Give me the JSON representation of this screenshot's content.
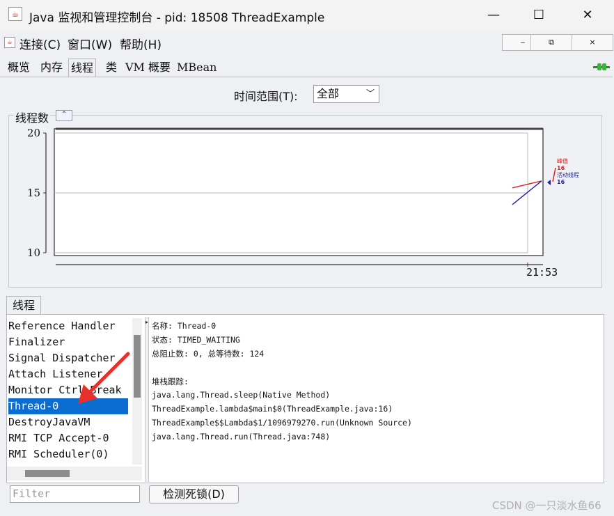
{
  "window": {
    "title": "Java 监视和管理控制台 - pid: 18508 ThreadExample",
    "minimize": "—",
    "maximize": "☐",
    "close": "✕",
    "app_icon": "java-cup-icon"
  },
  "menu": {
    "items": [
      "连接(C)",
      "窗口(W)",
      "帮助(H)"
    ],
    "inner_minimize": "‒",
    "inner_restore": "⧉",
    "inner_close": "×"
  },
  "tabs": [
    {
      "label": "概览",
      "active": false
    },
    {
      "label": "内存",
      "active": false
    },
    {
      "label": "线程",
      "active": true
    },
    {
      "label": "类",
      "active": false
    },
    {
      "label": "VM 概要",
      "active": false
    },
    {
      "label": "MBean",
      "active": false
    }
  ],
  "time_range": {
    "label": "时间范围(T):",
    "selected": "全部"
  },
  "chart_panel": {
    "title": "线程数",
    "collapse_icon": "collapse-up-icon"
  },
  "chart_data": {
    "type": "line",
    "y_ticks": [
      "20",
      "15",
      "10"
    ],
    "ylim": [
      10,
      20
    ],
    "x_ticks": [
      "21:53"
    ],
    "series": [
      {
        "name": "峰值",
        "value": "16",
        "color": "#e02020"
      },
      {
        "name": "活动线程",
        "value": "16",
        "color": "#2020b0"
      }
    ],
    "grid": true
  },
  "threads_panel": {
    "title": "线程",
    "items": [
      "Reference Handler",
      "Finalizer",
      "Signal Dispatcher",
      "Attach Listener",
      "Monitor Ctrl-Break",
      "Thread-0",
      "DestroyJavaVM",
      "RMI TCP Accept-0",
      "RMI Scheduler(0)"
    ],
    "selected_index": 5,
    "filter_placeholder": "Filter",
    "deadlock_button": "检测死锁(D)"
  },
  "thread_detail": {
    "name_line": "名称: Thread-0",
    "state_line": "状态: TIMED_WAITING",
    "counts_line": "总阻止数: 0, 总等待数: 124",
    "stack_header": "堆栈跟踪:",
    "stack": [
      "java.lang.Thread.sleep(Native Method)",
      "ThreadExample.lambda$main$0(ThreadExample.java:16)",
      "ThreadExample$$Lambda$1/1096979270.run(Unknown Source)",
      "java.lang.Thread.run(Thread.java:748)"
    ]
  },
  "watermark": "CSDN @一只淡水鱼66",
  "colors": {
    "selection": "#0b6dd0",
    "annotation_arrow": "#e8302a"
  }
}
